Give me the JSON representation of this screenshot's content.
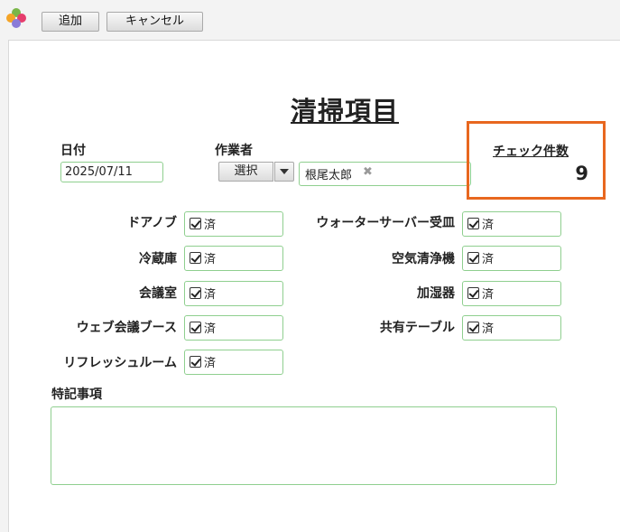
{
  "toolbar": {
    "add_label": "追加",
    "cancel_label": "キャンセル"
  },
  "form": {
    "title": "清掃項目",
    "date": {
      "label": "日付",
      "value": "2025/07/11"
    },
    "worker": {
      "label": "作業者",
      "select_label": "選択",
      "value": "根尾太郎",
      "remove_glyph": "✖"
    },
    "check_count": {
      "label": "チェック件数",
      "value": "9"
    },
    "left_items": [
      {
        "label": "ドアノブ",
        "value": "済"
      },
      {
        "label": "冷蔵庫",
        "value": "済"
      },
      {
        "label": "会議室",
        "value": "済"
      },
      {
        "label": "ウェブ会議ブース",
        "value": "済"
      },
      {
        "label": "リフレッシュルーム",
        "value": "済"
      }
    ],
    "right_items": [
      {
        "label": "ウォーターサーバー受皿",
        "value": "済"
      },
      {
        "label": "空気清浄機",
        "value": "済"
      },
      {
        "label": "加湿器",
        "value": "済"
      },
      {
        "label": "共有テーブル",
        "value": "済"
      }
    ],
    "notes": {
      "label": "特記事項",
      "value": ""
    }
  },
  "colors": {
    "highlight": "#e8671f",
    "field_border": "#8fcf8f"
  }
}
